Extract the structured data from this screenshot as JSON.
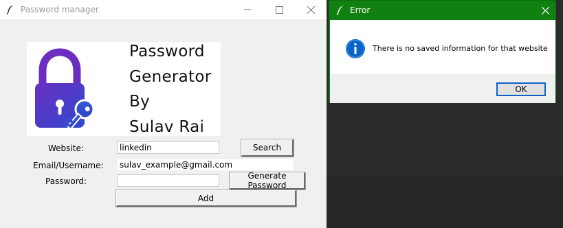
{
  "main_window": {
    "title": "Password manager",
    "logo": {
      "lines": [
        "Password",
        "Generator",
        "By",
        "Sulav Rai"
      ]
    },
    "form": {
      "website_label": "Website:",
      "website_value": "linkedin",
      "search_label": "Search",
      "email_label": "Email/Username:",
      "email_value": "sulav_example@gmail.com",
      "password_label": "Password:",
      "password_value": "",
      "generate_label": "Generate Password",
      "add_label": "Add"
    }
  },
  "dialog": {
    "title": "Error",
    "message": "There is no saved information for that website",
    "ok_label": "OK",
    "icon": "info-icon",
    "accent": "#108010"
  },
  "colors": {
    "window_bg": "#f0f0f0",
    "lock_gradient_start": "#6a2fc0",
    "lock_gradient_end": "#2d4fd0",
    "info_blue": "#0a64c8"
  }
}
